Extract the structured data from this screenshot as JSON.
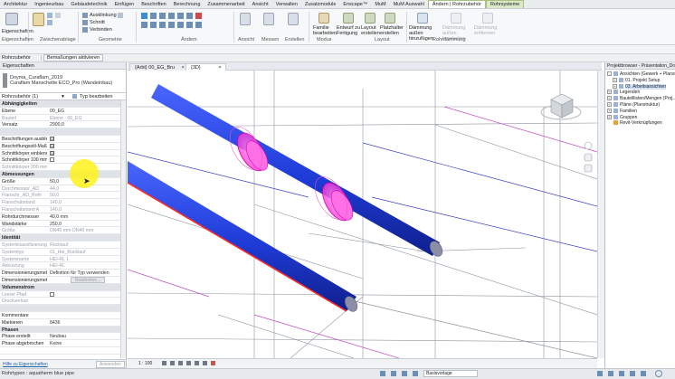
{
  "tabs": [
    "Architektur",
    "Ingenieurbau",
    "Gebäudetechnik",
    "Einfügen",
    "Beschriften",
    "Berechnung",
    "Zusammenarbeit",
    "Ansicht",
    "Verwalten",
    "Zusatzmodule",
    "Enscape™",
    "MuM",
    "MuM Auswahl",
    "Ändern | Rohrzubehör",
    "Rohrsysteme"
  ],
  "ribbon": {
    "groups": [
      "Eigenschaften",
      "Zwischenablage",
      "Geometrie",
      "Ändern",
      "Ansicht",
      "Messen",
      "Erstellen",
      "Modus",
      "Layout",
      "Rohrdämmung"
    ],
    "buttons": {
      "eigenschaften": "Eigenschaften",
      "ausklinkung": "Ausklinkung",
      "schnitt": "Schnitt",
      "verbinden": "Verbinden",
      "familie_bearbeiten": "Familie bearbeiten",
      "entwurf_fertigung": "Entwurf zu Fertigung",
      "layout_erstellen": "Layout erstellen",
      "platzhalter_erstellen": "Platzhalter erstellen",
      "daemmung_auslen": "Dämmung außen hinzufügen",
      "daemmung_bearbeiten": "Dämmung außen bearbeiten",
      "daemmung_entfernen": "Dämmung entfernen"
    }
  },
  "optionsbar": {
    "context": "Rohrzubehör",
    "activate": "Bemaßungen aktivieren"
  },
  "properties": {
    "title": "Eigenschaften",
    "type_line1": "Doyma_Curaflam_2019",
    "type_line2": "Curaflam Manschette ECO_Pro (Wandeinbau)",
    "filter": "Rohrzubehör (1)",
    "edit_type": "Typ bearbeiten",
    "rows": [
      {
        "k": "Abhängigkeiten",
        "v": "",
        "section": true
      },
      {
        "k": "Ebene",
        "v": "00_EG"
      },
      {
        "k": "Bauteil",
        "v": "Ebene : 00_EG",
        "grey": true
      },
      {
        "k": "Versatz",
        "v": "2900,0"
      },
      {
        "k": "",
        "v": "",
        "section": true
      },
      {
        "k": "Beschriftungen ausblenden",
        "v": "☑",
        "cb": true
      },
      {
        "k": "Beschriftungsstil-Maßstab ver...",
        "v": "☑",
        "cb": true
      },
      {
        "k": "Schnittkörper einblenden",
        "v": "☑",
        "cb": true
      },
      {
        "k": "Schnittkörper 100 mm",
        "v": "",
        "cb": true
      },
      {
        "k": "Schnittkörper 200 mm",
        "v": "",
        "grey": true
      },
      {
        "k": "Abmessungen",
        "v": "",
        "section": true
      },
      {
        "k": "Größe",
        "v": "50,0"
      },
      {
        "k": "Durchmesser_AD",
        "v": "44,0",
        "grey": true
      },
      {
        "k": "Flanschr_AD_Rohr",
        "v": "50,0",
        "grey": true
      },
      {
        "k": "Flanschabstand",
        "v": "140,0",
        "grey": true
      },
      {
        "k": "Flanschabstand A",
        "v": "140,0",
        "grey": true
      },
      {
        "k": "Rohrdurchmesser",
        "v": "40,0 mm"
      },
      {
        "k": "Wandstärke",
        "v": "250,0"
      },
      {
        "k": "Größe",
        "v": "DN40 mm-DN40 mm",
        "grey": true
      },
      {
        "k": "Identität",
        "v": "",
        "section": true
      },
      {
        "k": "Systemklassifizierung",
        "v": "Rücklauf",
        "grey": true
      },
      {
        "k": "Systemtyp",
        "v": "01_Hei_Rücklauf",
        "grey": true
      },
      {
        "k": "Systemname",
        "v": "HEI-RL 1",
        "grey": true
      },
      {
        "k": "Abkürzung",
        "v": "HEI-RL",
        "grey": true
      },
      {
        "k": "Dimensionierungsmethode für Druc...",
        "v": "Definition für Typ verwenden"
      },
      {
        "k": "Dimensionierungsmethode für Druc...",
        "v": "Bearbeiten...",
        "btn": true
      },
      {
        "k": "Volumenstrom",
        "v": "",
        "section": true
      },
      {
        "k": "Leerer Pfad",
        "v": "",
        "cb": true,
        "grey": true
      },
      {
        "k": "Druckverlust",
        "v": "",
        "grey": true
      },
      {
        "k": "",
        "v": "",
        "section": true
      },
      {
        "k": "Kommentare",
        "v": ""
      },
      {
        "k": "Markieren",
        "v": "8436"
      },
      {
        "k": "Phasen",
        "v": "",
        "section": true
      },
      {
        "k": "Phase erstellt",
        "v": "Neubau"
      },
      {
        "k": "Phase abgebrochen",
        "v": "Keine"
      },
      {
        "k": "",
        "v": ""
      }
    ],
    "help_link": "Hilfe zu Eigenschaften",
    "apply": "Anwenden"
  },
  "viewtabs": [
    "{Arbt} 00_EG_Bru",
    "{3D}"
  ],
  "viewbar": {
    "scale": "1 : 100"
  },
  "browser": {
    "title": "Projektbrowser - Präsentation_Doy...",
    "items": [
      {
        "label": "Ansichten (Gewerk + Planst...",
        "level": 0,
        "sign": "-"
      },
      {
        "label": "01. Projekt Setup",
        "level": 1,
        "sign": "+"
      },
      {
        "label": "03. Arbeitsansichten",
        "level": 1,
        "sign": "+",
        "sel": true
      },
      {
        "label": "Legenden",
        "level": 0,
        "sign": "+"
      },
      {
        "label": "Bauteillisten/Mengen (Proj...",
        "level": 0,
        "sign": "+"
      },
      {
        "label": "Pläne (Planstruktur)",
        "level": 0,
        "sign": "+"
      },
      {
        "label": "Familien",
        "level": 0,
        "sign": "+"
      },
      {
        "label": "Gruppen",
        "level": 0,
        "sign": "+"
      },
      {
        "label": "Revit-Verknüpfungen",
        "level": 0,
        "sign": ""
      }
    ]
  },
  "status": {
    "text": "Rohrtypen : aquatherm blue pipe",
    "workset": "Basisvorlage"
  },
  "colors": {
    "pipe": "#1f3bd6",
    "sleeve": "#ff3ed8",
    "accent": "#2e7d32"
  }
}
